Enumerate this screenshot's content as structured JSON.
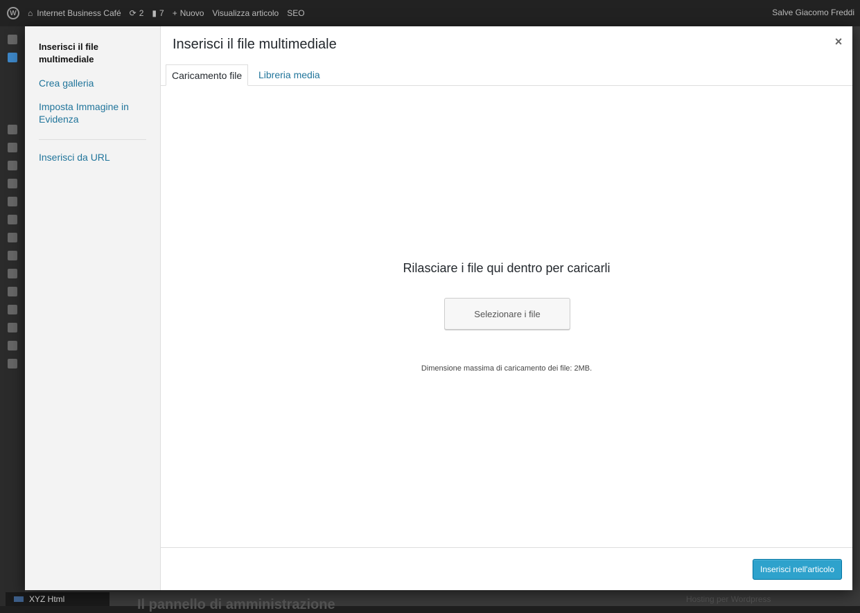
{
  "adminbar": {
    "site_name": "Internet Business Café",
    "updates_count": "2",
    "comments_count": "7",
    "new_label": "Nuovo",
    "view_post_label": "Visualizza articolo",
    "seo_label": "SEO",
    "greeting": "Salve Giacomo Freddi"
  },
  "background": {
    "plugin_label": "XYZ Html",
    "page_heading": "Il pannello di amministrazione",
    "side_widget_text": "Hosting per Wordpress"
  },
  "modal": {
    "menu": {
      "items": [
        {
          "label": "Inserisci il file multimediale",
          "active": true
        },
        {
          "label": "Crea galleria",
          "active": false
        },
        {
          "label": "Imposta Immagine in Evidenza",
          "active": false
        },
        {
          "label": "Inserisci da URL",
          "active": false
        }
      ]
    },
    "title": "Inserisci il file multimediale",
    "close_symbol": "×",
    "tabs": [
      {
        "label": "Caricamento file",
        "active": true
      },
      {
        "label": "Libreria media",
        "active": false
      }
    ],
    "drop_text": "Rilasciare i file qui dentro per caricarli",
    "select_button": "Selezionare i file",
    "max_size": "Dimensione massima di caricamento dei file: 2MB.",
    "insert_button": "Inserisci nell'articolo"
  },
  "colors": {
    "link": "#21759b",
    "primary_button": "#2ea2cc",
    "adminbar_bg": "#222222"
  }
}
